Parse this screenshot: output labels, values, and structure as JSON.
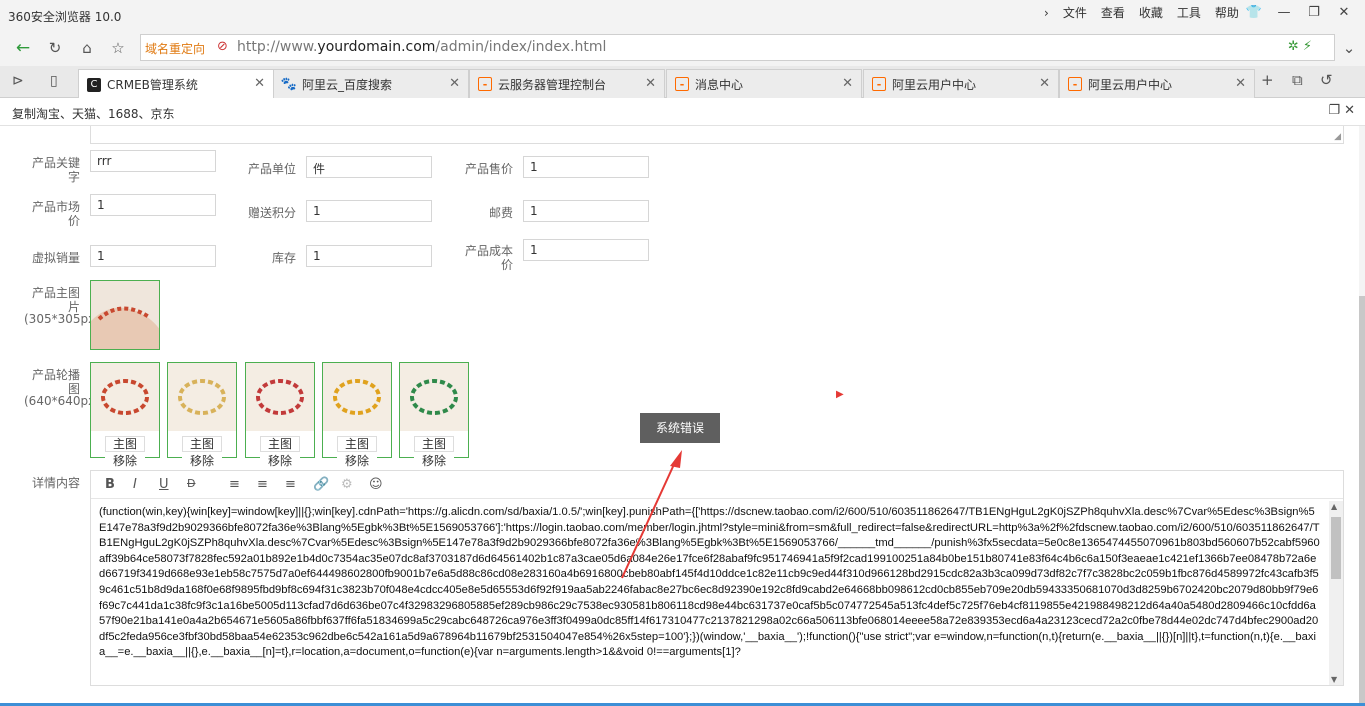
{
  "browser": {
    "title": "360安全浏览器 10.0",
    "menu": [
      "文件",
      "查看",
      "收藏",
      "工具",
      "帮助"
    ],
    "redirect_label": "域名重定向",
    "url_prefix": "http://www.",
    "url_domain": "yourdomain.com",
    "url_path": "/admin/index/index.html",
    "tabs": [
      {
        "label": "CRMEB管理系统",
        "icon": "crmeb-icon",
        "active": true
      },
      {
        "label": "阿里云_百度搜索",
        "icon": "baidu-paw-icon",
        "active": false
      },
      {
        "label": "云服务器管理控制台",
        "icon": "aliyun-icon",
        "active": false
      },
      {
        "label": "消息中心",
        "icon": "aliyun-icon",
        "active": false
      },
      {
        "label": "阿里云用户中心",
        "icon": "aliyun-icon",
        "active": false
      },
      {
        "label": "阿里云用户中心",
        "icon": "aliyun-icon",
        "active": false
      }
    ],
    "favorites_text": "复制淘宝、天猫、1688、京东"
  },
  "form": {
    "keyword": {
      "label": "产品关键字",
      "value": "rrr"
    },
    "unit": {
      "label": "产品单位",
      "value": "件"
    },
    "price": {
      "label": "产品售价",
      "value": "1"
    },
    "market_price": {
      "label": "产品市场价",
      "value": "1"
    },
    "give_points": {
      "label": "赠送积分",
      "value": "1"
    },
    "postage": {
      "label": "邮费",
      "value": "1"
    },
    "virtual_sales": {
      "label": "虚拟销量",
      "value": "1"
    },
    "stock": {
      "label": "库存",
      "value": "1"
    },
    "cost": {
      "label": "产品成本价",
      "value": "1"
    },
    "main_image": {
      "label": "产品主图片",
      "size_hint": "(305*305px"
    },
    "carousel": {
      "label": "产品轮播图",
      "size_hint": "(640*640px",
      "main_btn": "主图",
      "remove_btn": "移除",
      "colors": [
        "#c8482f",
        "#d8b25a",
        "#c23a3a",
        "#e0a21e",
        "#2f8a4a"
      ]
    },
    "details_label": "详情内容"
  },
  "editor": {
    "content": "(function(win,key){win[key]=window[key]||{};win[key].cdnPath='https://g.alicdn.com/sd/baxia/1.0.5/';win[key].punishPath={['https://dscnew.taobao.com/i2/600/510/603511862647/TB1ENgHguL2gK0jSZPh8quhvXla.desc%7Cvar%5Edesc%3Bsign%5E147e78a3f9d2b9029366bfe8072fa36e%3Blang%5Egbk%3Bt%5E1569053766']:'https://login.taobao.com/member/login.jhtml?style=mini&from=sm&full_redirect=false&redirectURL=http%3a%2f%2fdscnew.taobao.com/i2/600/510/603511862647/TB1ENgHguL2gK0jSZPh8quhvXla.desc%7Cvar%5Edesc%3Bsign%5E147e78a3f9d2b9029366bfe8072fa36e%3Blang%5Egbk%3Bt%5E1569053766/______tmd______/punish%3fx5secdata=5e0c8e1365474455070961b803bd560607b52cabf5960aff39b64ce58073f7828fec592a01b892e1b4d0c7354ac35e07dc8af3703187d6d64561402b1c87a3cae05d6a084e26e17fce6f28abaf9fc951746941a5f9f2cad199100251a84b0be151b80741e83f64c4b6c6a150f3eaeae1c421ef1366b7ee08478b72a6ed66719f3419d668e93e1eb58c7575d7a0ef644498602800fb9001b7e6a5d88c86cd08e283160a4b6916800cbeb80abf145f4d10ddce1c82e11cb9c9ed44f310d966128bd2915cdc82a3b3ca099d73df82c7f7c3828bc2c059b1fbc876d4589972fc43cafb3f59c461c51b8d9da168f0e68f9895fbd9bf8c694f31c3823b70f048e4cdcc405e8e5d65553d6f92f919aa5ab2246fabac8e27bc6ec8d92390e192c8fd9cabd2e64668bb098612cd0cb855eb709e20db59433350681070d3d8259b6702420bc2079d80bb9f79e6f69c7c441da1c38fc9f3c1a16be5005d113cfad7d6d636be07c4f32983296805885ef289cb986c29c7538ec930581b806118cd98e44bc631737e0caf5b5c074772545a513fc4def5c725f76eb4cf8119855e421988498212d64a40a5480d2809466c10cfdd6a57f90e21ba141e0a4a2b654671e5605a86fbbf637ff6fa51834699a5c29cabc648726ca976e3ff3f0499a0dc85ff14f617310477c2137821298a02c66a506113bfe068014eeee58a72e839353ecd6a4a23123cecd72a2c0fbe78d44e02dc747d4bfec2900ad20df5c2feda956ce3fbf30bd58baa54e62353c962dbe6c542a161a5d9a678964b11679bf2531504047e854%26x5step=100'};})(window,'__baxia__');!function(){\"use strict\";var e=window,n=function(n,t){return(e.__baxia__||{})[n]||t},t=function(n,t){e.__baxia__=e.__baxia__||{},e.__baxia__[n]=t},r=location,a=document,o=function(e){var n=arguments.length>1&&void 0!==arguments[1]?"
  },
  "error_tip": "系统错误",
  "colors": {
    "accent_blue": "#3d8fd6",
    "success_green": "#4caf50",
    "error_red": "#e53935",
    "tip_bg": "#5f5f5f"
  }
}
